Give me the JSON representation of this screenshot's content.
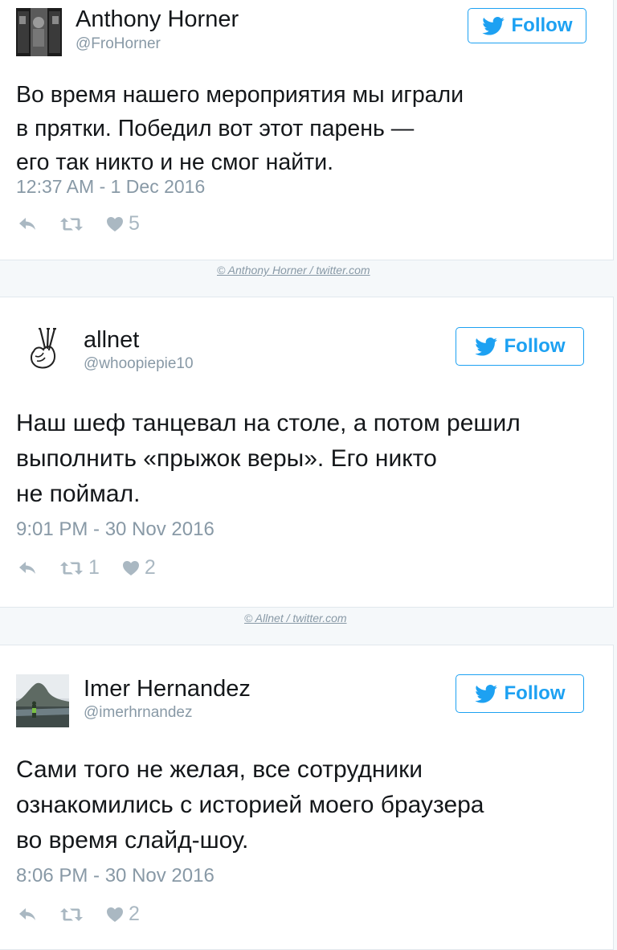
{
  "follow_label": "Follow",
  "accent_color": "#1da1f2",
  "tweets": [
    {
      "name": "Anthony Horner",
      "handle": "@FroHorner",
      "text_lines": [
        "Во время нашего мероприятия мы играли",
        "в прятки. Победил вот этот парень —",
        "его так никто и не смог найти."
      ],
      "timestamp": "12:37 AM - 1 Dec 2016",
      "retweets": "",
      "likes": "5",
      "credit": "© Anthony Horner / twitter.com"
    },
    {
      "name": "allnet",
      "handle": "@whoopiepie10",
      "text_lines": [
        "Наш шеф танцевал на столе, а потом решил",
        "выполнить «прыжок веры». Его никто",
        "не поймал."
      ],
      "timestamp": "9:01 PM - 30 Nov 2016",
      "retweets": "1",
      "likes": "2",
      "credit": "© Allnet / twitter.com"
    },
    {
      "name": "Imer Hernandez",
      "handle": "@imerhrnandez",
      "text_lines": [
        "Сами того не желая, все сотрудники",
        "ознакомились с историей моего браузера",
        "во время слайд-шоу."
      ],
      "timestamp": "8:06 PM - 30 Nov 2016",
      "retweets": "",
      "likes": "2"
    }
  ]
}
